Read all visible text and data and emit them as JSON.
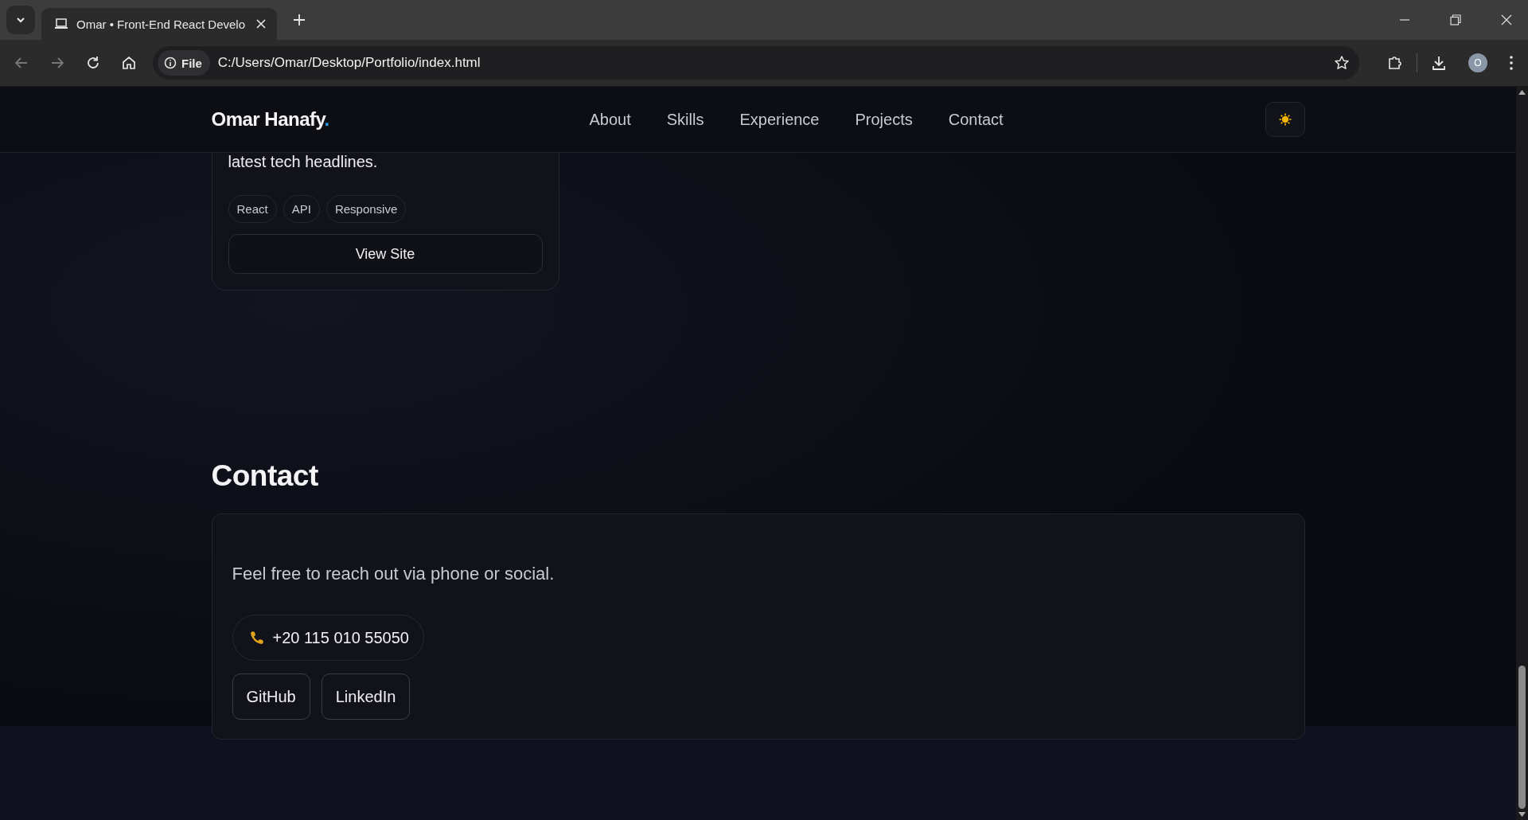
{
  "browser": {
    "tabs": [
      {
        "title": "Omar • Front-End React Develo",
        "selected": true
      }
    ],
    "address": {
      "badge": "File",
      "url": "C:/Users/Omar/Desktop/Portfolio/index.html"
    },
    "profile_initial": "O"
  },
  "nav": {
    "brand": "Omar Hanafy",
    "brand_dot": ".",
    "links": [
      "About",
      "Skills",
      "Experience",
      "Projects",
      "Contact"
    ]
  },
  "project": {
    "description": "latest tech headlines.",
    "tags": [
      "React",
      "API",
      "Responsive"
    ],
    "button": "View Site"
  },
  "contact": {
    "heading": "Contact",
    "text": "Feel free to reach out via phone or social.",
    "phone": "+20 115 010 55050",
    "links": [
      "GitHub",
      "LinkedIn"
    ]
  }
}
